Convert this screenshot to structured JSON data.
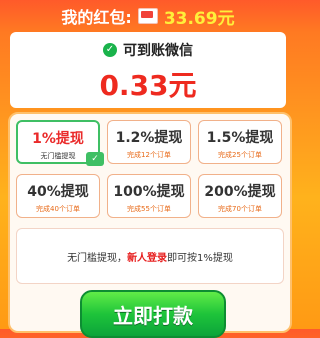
{
  "balance": {
    "label": "我的红包:",
    "amount": "33.69元"
  },
  "payout": {
    "status_text": "可到账微信",
    "value": "0.33元"
  },
  "options": [
    {
      "title": "1%提现",
      "subtitle": "无门槛提现",
      "selected": true
    },
    {
      "title": "1.2%提现",
      "subtitle": "完成12个订单"
    },
    {
      "title": "1.5%提现",
      "subtitle": "完成25个订单"
    },
    {
      "title": "40%提现",
      "subtitle": "完成40个订单"
    },
    {
      "title": "100%提现",
      "subtitle": "完成55个订单"
    },
    {
      "title": "200%提现",
      "subtitle": "完成70个订单"
    }
  ],
  "tips": {
    "pre": "无门槛提现，",
    "highlight": "新人登录",
    "post": "即可按1%提现"
  },
  "cta": {
    "label": "立即打款"
  },
  "colors": {
    "accent_red": "#ee2a1f",
    "cta_green": "#1ec43a"
  },
  "icons": {
    "envelope": "red-envelope-icon",
    "check": "check-circle-icon"
  }
}
